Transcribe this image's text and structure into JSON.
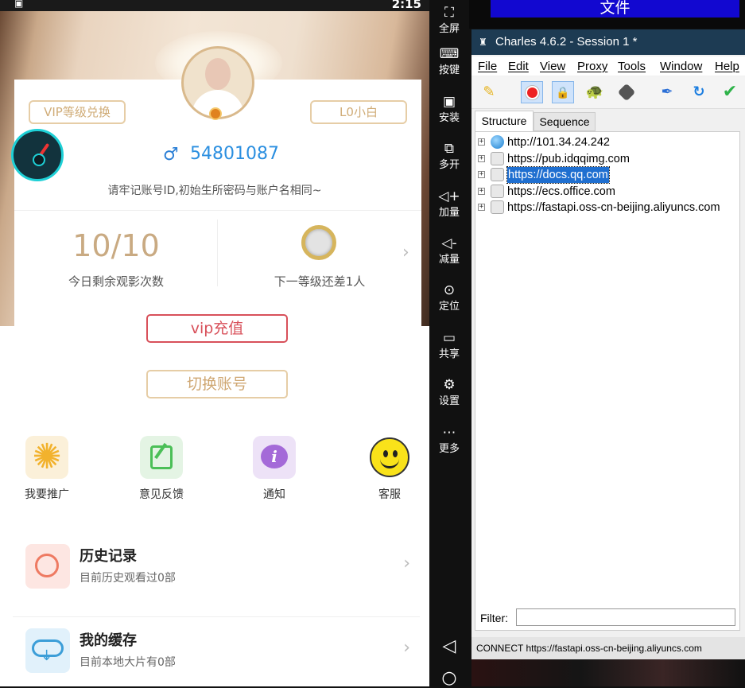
{
  "phone": {
    "statusbar": {
      "time": "2:15"
    },
    "vip_exchange": "VIP等级兑换",
    "level": "L0小白",
    "gender_icon": "♂",
    "account_id": "54801087",
    "account_hint": "请牢记账号ID,初始生所密码与账户名相同~",
    "views_count": "10/10",
    "views_label": "今日剩余观影次数",
    "next_level": "下一等级还差1人",
    "vip_recharge": "vip充值",
    "switch_account": "切换账号",
    "features": [
      {
        "label": "我要推广",
        "icon": "sun-icon"
      },
      {
        "label": "意见反馈",
        "icon": "edit-icon"
      },
      {
        "label": "通知",
        "icon": "info-icon"
      },
      {
        "label": "客服",
        "icon": "smiley-headset-icon"
      }
    ],
    "history": {
      "title": "历史记录",
      "subtitle": "目前历史观看过0部"
    },
    "cache": {
      "title": "我的缓存",
      "subtitle": "目前本地大片有0部"
    },
    "chevron": "›"
  },
  "emulator": {
    "buttons": [
      {
        "label": "全屏",
        "icon": "⛶"
      },
      {
        "label": "按键",
        "icon": "⌨"
      },
      {
        "label": "安装",
        "icon": "▣"
      },
      {
        "label": "多开",
        "icon": "⧉"
      },
      {
        "label": "加量",
        "icon": "◁+"
      },
      {
        "label": "减量",
        "icon": "◁-"
      },
      {
        "label": "定位",
        "icon": "⊙"
      },
      {
        "label": "共享",
        "icon": "▭"
      },
      {
        "label": "设置",
        "icon": "⚙"
      },
      {
        "label": "更多",
        "icon": "⋯"
      }
    ],
    "back_icon": "◁",
    "home_icon": "○"
  },
  "charles": {
    "file_tab": "文件",
    "title": "Charles 4.6.2 - Session 1 *",
    "menu": [
      "File",
      "Edit",
      "View",
      "Proxy",
      "Tools",
      "Window",
      "Help"
    ],
    "tabs": {
      "structure": "Structure",
      "sequence": "Sequence"
    },
    "hosts": [
      {
        "text": "http://101.34.24.242",
        "selected": false
      },
      {
        "text": "https://pub.idqqimg.com",
        "selected": false
      },
      {
        "text": "https://docs.qq.com",
        "selected": true
      },
      {
        "text": "https://ecs.office.com",
        "selected": false
      },
      {
        "text": "https://fastapi.oss-cn-beijing.aliyuncs.com",
        "selected": false
      }
    ],
    "filter_label": "Filter:",
    "filter_value": "",
    "status": "CONNECT https://fastapi.oss-cn-beijing.aliyuncs.com"
  }
}
